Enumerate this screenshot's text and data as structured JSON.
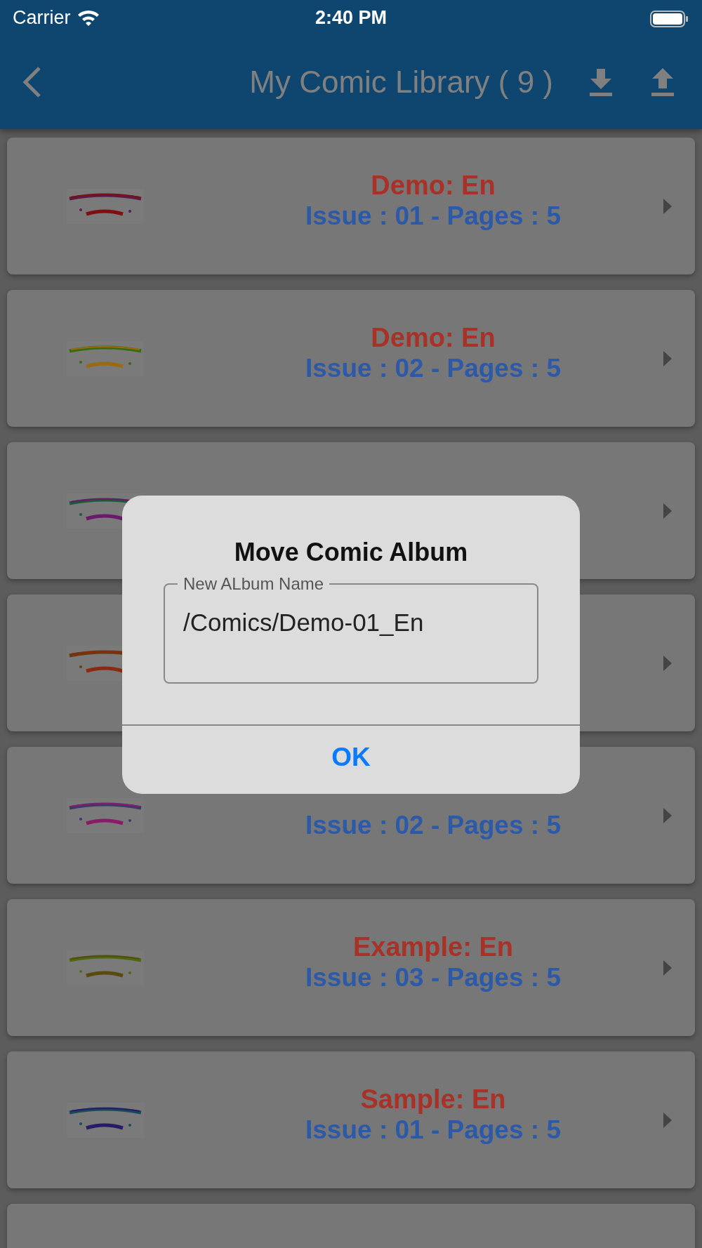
{
  "status_bar": {
    "carrier": "Carrier",
    "time": "2:40 PM"
  },
  "app_bar": {
    "title": "My Comic Library ( 9 )"
  },
  "albums": [
    {
      "cover": {
        "kind": "picture"
      },
      "title": "Demo: En",
      "subtitle": "Issue : 01 - Pages : 5"
    },
    {
      "cover": {
        "kind": "picture"
      },
      "title": "Demo: En",
      "subtitle": "Issue : 02 - Pages : 5"
    },
    {
      "cover": {
        "kind": "picture"
      }
    },
    {
      "cover": {
        "kind": "picture"
      }
    },
    {
      "cover": {
        "kind": "picture"
      },
      "subtitle": "Issue : 02 - Pages : 5"
    },
    {
      "cover": {
        "kind": "picture"
      },
      "title": "Example: En",
      "subtitle": "Issue : 03 - Pages : 5"
    },
    {
      "cover": {
        "kind": "picture"
      },
      "title": "Sample: En",
      "subtitle": "Issue : 01 - Pages : 5"
    },
    {
      "partial": true
    }
  ],
  "dialog": {
    "title": "Move Comic Album",
    "field": {
      "label": "New ALbum Name",
      "value": "/Comics/Demo-01_En"
    },
    "buttons": [
      "OK"
    ]
  }
}
